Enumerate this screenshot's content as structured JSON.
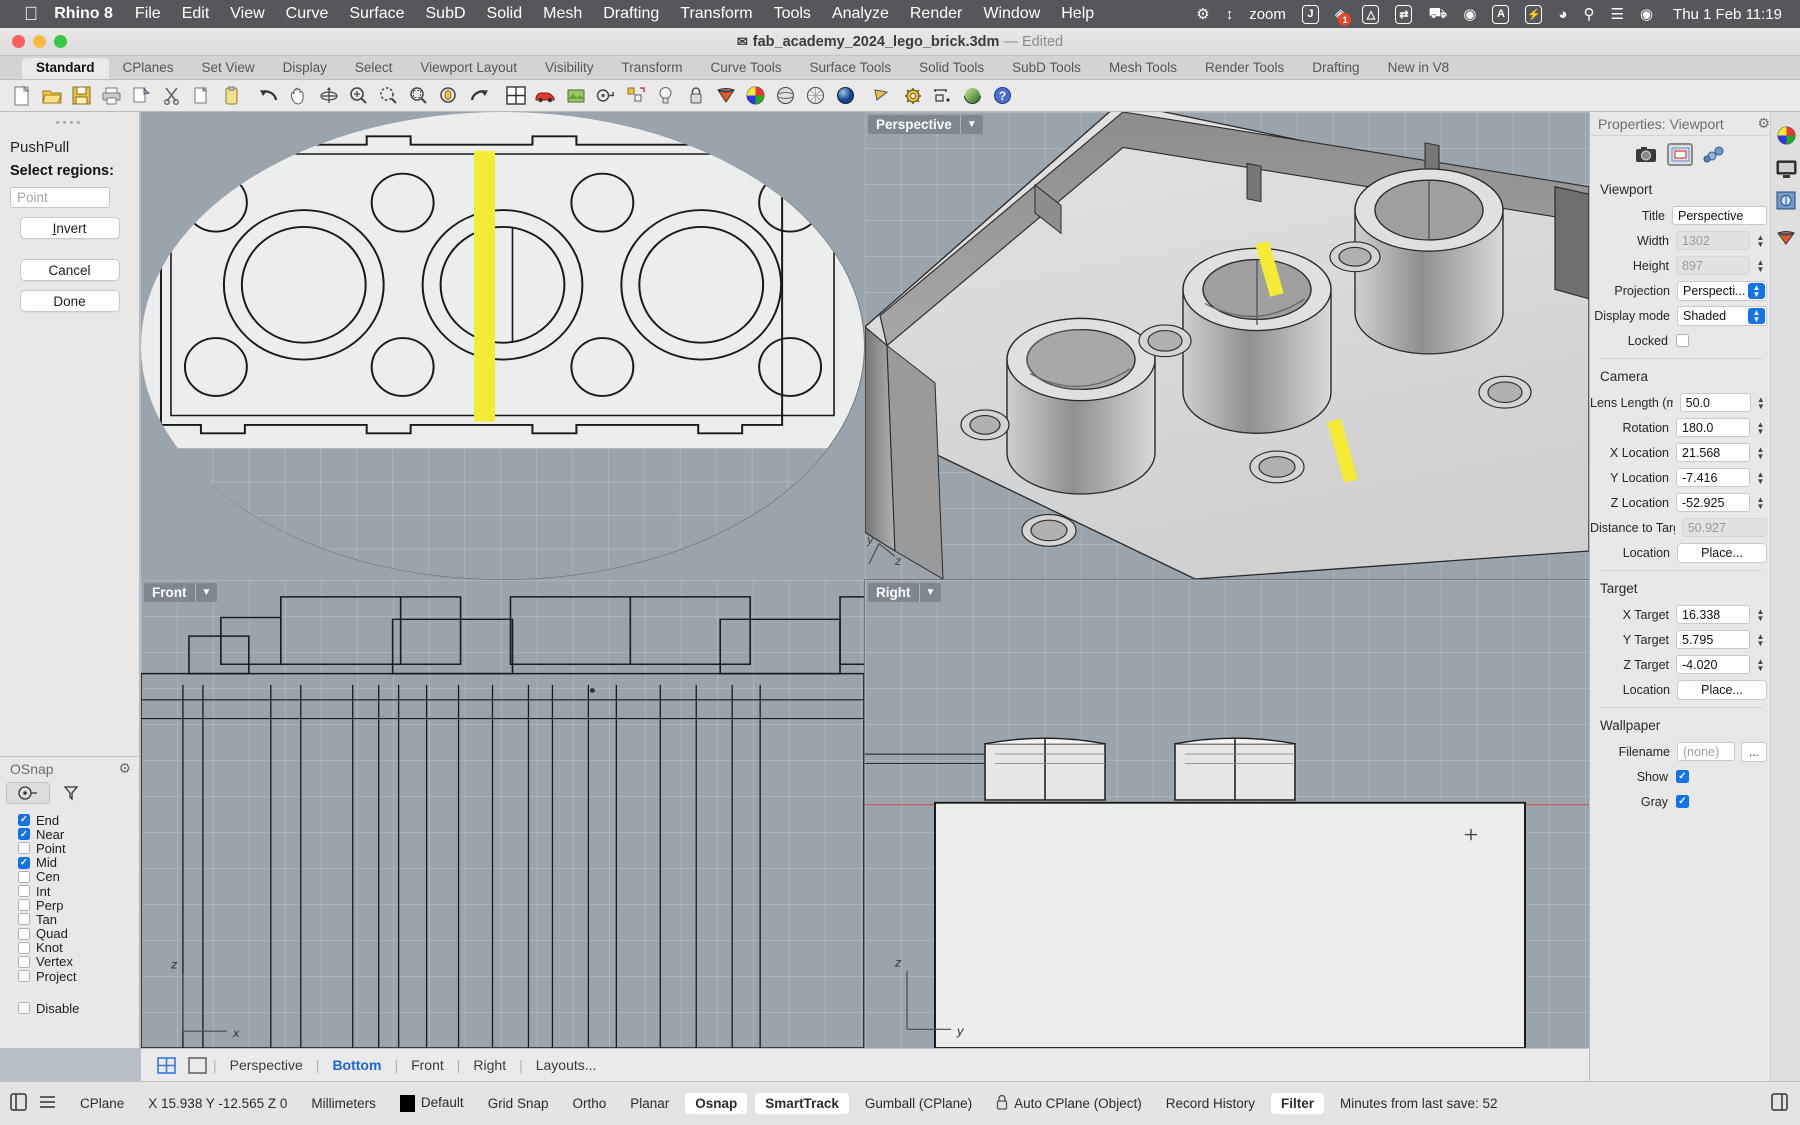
{
  "macbar": {
    "apple_icon": "apple-logo",
    "app_name": "Rhino 8",
    "menus": [
      "File",
      "Edit",
      "View",
      "Curve",
      "Surface",
      "SubD",
      "Solid",
      "Mesh",
      "Drafting",
      "Transform",
      "Tools",
      "Analyze",
      "Render",
      "Window",
      "Help"
    ],
    "status_icons": [
      "gear-icon",
      "arrows-vertical-icon",
      "zoom-label",
      "jamf-icon",
      "dropbox-icon",
      "drive-icon",
      "screenshot-icon",
      "plug-icon",
      "play-circle-icon",
      "keyboard-input-icon",
      "battery-charging-icon",
      "wifi-icon",
      "search-icon",
      "control-center-icon",
      "siri-icon"
    ],
    "zoom_label": "zoom",
    "badge_count": "1",
    "input_source": "A",
    "clock": "Thu 1 Feb  11:19"
  },
  "window": {
    "doc_icon": "rhino-doc-icon",
    "title": "fab_academy_2024_lego_brick.3dm",
    "dash": "—",
    "edited": "Edited"
  },
  "toolbar": {
    "tabs": [
      {
        "label": "Standard",
        "active": true
      },
      {
        "label": "CPlanes",
        "active": false
      },
      {
        "label": "Set View",
        "active": false
      },
      {
        "label": "Display",
        "active": false
      },
      {
        "label": "Select",
        "active": false
      },
      {
        "label": "Viewport Layout",
        "active": false
      },
      {
        "label": "Visibility",
        "active": false
      },
      {
        "label": "Transform",
        "active": false
      },
      {
        "label": "Curve Tools",
        "active": false
      },
      {
        "label": "Surface Tools",
        "active": false
      },
      {
        "label": "Solid Tools",
        "active": false
      },
      {
        "label": "SubD Tools",
        "active": false
      },
      {
        "label": "Mesh Tools",
        "active": false
      },
      {
        "label": "Render Tools",
        "active": false
      },
      {
        "label": "Drafting",
        "active": false
      },
      {
        "label": "New in V8",
        "active": false
      }
    ],
    "icons": [
      {
        "name": "new-file-icon",
        "glyph": "📄"
      },
      {
        "name": "open-file-icon",
        "glyph": "📂"
      },
      {
        "name": "save-icon",
        "glyph": "💾"
      },
      {
        "name": "print-icon",
        "glyph": "🖨"
      },
      {
        "name": "copy-to-clipboard-icon",
        "glyph": "🗒"
      },
      {
        "name": "cut-icon",
        "glyph": "✂"
      },
      {
        "name": "copy-icon",
        "glyph": "🗐"
      },
      {
        "name": "paste-icon",
        "glyph": "📋"
      },
      {
        "name": "undo-icon",
        "glyph": "↶"
      },
      {
        "name": "pan-icon",
        "glyph": "✋"
      },
      {
        "name": "rotate-view-icon",
        "glyph": "⟳"
      },
      {
        "name": "zoom-window-icon",
        "glyph": "🔍"
      },
      {
        "name": "zoom-extents-icon",
        "glyph": "⬭"
      },
      {
        "name": "zoom-selected-icon",
        "glyph": "⌕"
      },
      {
        "name": "zoom-target-icon",
        "glyph": "◎"
      },
      {
        "name": "rotate-icon",
        "glyph": "↷"
      },
      {
        "name": "viewport-layout-icon",
        "glyph": "⊞"
      },
      {
        "name": "car-render-icon",
        "glyph": "🚗"
      },
      {
        "name": "render-preview-icon",
        "glyph": "🎞"
      },
      {
        "name": "layers-icon",
        "glyph": "⊙"
      },
      {
        "name": "object-properties-icon",
        "glyph": "⚙"
      },
      {
        "name": "light-icon",
        "glyph": "💡"
      },
      {
        "name": "lock-icon",
        "glyph": "🔒"
      },
      {
        "name": "surface-icon",
        "glyph": "◣"
      },
      {
        "name": "color-wheel-icon",
        "glyph": "🎨"
      },
      {
        "name": "sphere-icon",
        "glyph": "🌑"
      },
      {
        "name": "mesh-sphere-icon",
        "glyph": "🔘"
      },
      {
        "name": "shaded-sphere-icon",
        "glyph": "🔵"
      },
      {
        "name": "gumball-icon",
        "glyph": "◤"
      },
      {
        "name": "grasshopper-icon",
        "glyph": "⚙"
      },
      {
        "name": "dimension-icon",
        "glyph": "⊢"
      },
      {
        "name": "render-sphere-icon",
        "glyph": "🟢"
      },
      {
        "name": "help-icon",
        "glyph": "❓"
      }
    ]
  },
  "command_panel": {
    "command_name": "PushPull",
    "prompt": "Select regions:",
    "input_placeholder": "Point",
    "buttons": [
      {
        "label": "Invert",
        "underline_first": true
      },
      {
        "label": "Cancel",
        "underline_first": false
      },
      {
        "label": "Done",
        "underline_first": false
      }
    ]
  },
  "osnap": {
    "title": "OSnap",
    "gear_icon": "gear-icon",
    "tabs": [
      {
        "name": "osnap-tab-points",
        "glyph": "⊶",
        "selected": true
      },
      {
        "name": "osnap-tab-filter",
        "glyph": "⌁",
        "selected": false
      }
    ],
    "items": [
      {
        "label": "End",
        "checked": true
      },
      {
        "label": "Near",
        "checked": true
      },
      {
        "label": "Point",
        "checked": false
      },
      {
        "label": "Mid",
        "checked": true
      },
      {
        "label": "Cen",
        "checked": false
      },
      {
        "label": "Int",
        "checked": false
      },
      {
        "label": "Perp",
        "checked": false
      },
      {
        "label": "Tan",
        "checked": false
      },
      {
        "label": "Quad",
        "checked": false
      },
      {
        "label": "Knot",
        "checked": false
      },
      {
        "label": "Vertex",
        "checked": false
      },
      {
        "label": "Project",
        "checked": false
      }
    ],
    "disable": {
      "label": "Disable",
      "checked": false
    }
  },
  "viewports": [
    {
      "name": "Bottom",
      "active": true
    },
    {
      "name": "Perspective",
      "active": false
    },
    {
      "name": "Front",
      "active": false
    },
    {
      "name": "Right",
      "active": false
    }
  ],
  "viewport_tabs": {
    "four_view_icon": "four-view-icon",
    "single_view_icon": "single-view-icon",
    "tabs": [
      {
        "label": "Perspective",
        "on": false
      },
      {
        "label": "Bottom",
        "on": true
      },
      {
        "label": "Front",
        "on": false
      },
      {
        "label": "Right",
        "on": false
      },
      {
        "label": "Layouts...",
        "on": false
      }
    ]
  },
  "properties": {
    "header": "Properties: Viewport",
    "gear_icon": "gear-icon",
    "tab_icons": [
      {
        "name": "camera-properties-icon",
        "glyph": "📷",
        "selected": false
      },
      {
        "name": "viewport-properties-icon",
        "glyph": "▣",
        "selected": true
      },
      {
        "name": "display-properties-icon",
        "glyph": "🔗",
        "selected": false
      }
    ],
    "sections": [
      {
        "title": "Viewport",
        "rows": [
          {
            "label": "Title",
            "type": "text",
            "value": "Perspective",
            "readonly": false
          },
          {
            "label": "Width",
            "type": "stepper",
            "value": "1302",
            "readonly": true
          },
          {
            "label": "Height",
            "type": "stepper",
            "value": "897",
            "readonly": true
          },
          {
            "label": "Projection",
            "type": "combo",
            "value": "Perspecti..."
          },
          {
            "label": "Display mode",
            "type": "combo",
            "value": "Shaded"
          },
          {
            "label": "Locked",
            "type": "checkbox",
            "checked": false
          }
        ]
      },
      {
        "title": "Camera",
        "rows": [
          {
            "label": "Lens Length (m",
            "type": "stepper",
            "value": "50.0",
            "readonly": false
          },
          {
            "label": "Rotation",
            "type": "stepper",
            "value": "180.0",
            "readonly": false
          },
          {
            "label": "X Location",
            "type": "stepper",
            "value": "21.568",
            "readonly": false
          },
          {
            "label": "Y Location",
            "type": "stepper",
            "value": "-7.416",
            "readonly": false
          },
          {
            "label": "Z Location",
            "type": "stepper",
            "value": "-52.925",
            "readonly": false
          },
          {
            "label": "Distance to Targ",
            "type": "text",
            "value": "50.927",
            "readonly": true
          },
          {
            "label": "Location",
            "type": "button",
            "value": "Place..."
          }
        ]
      },
      {
        "title": "Target",
        "rows": [
          {
            "label": "X Target",
            "type": "stepper",
            "value": "16.338",
            "readonly": false
          },
          {
            "label": "Y Target",
            "type": "stepper",
            "value": "5.795",
            "readonly": false
          },
          {
            "label": "Z Target",
            "type": "stepper",
            "value": "-4.020",
            "readonly": false
          },
          {
            "label": "Location",
            "type": "button",
            "value": "Place..."
          }
        ]
      },
      {
        "title": "Wallpaper",
        "rows": [
          {
            "label": "Filename",
            "type": "file",
            "value": "(none)",
            "browse": "..."
          },
          {
            "label": "Show",
            "type": "checkbox",
            "checked": true
          },
          {
            "label": "Gray",
            "type": "checkbox",
            "checked": true
          }
        ]
      }
    ],
    "side_icons": [
      {
        "name": "color-wheel-icon",
        "glyph": "🎨"
      },
      {
        "name": "display-monitor-icon",
        "glyph": "🖥"
      },
      {
        "name": "render-settings-icon",
        "glyph": "🖼"
      },
      {
        "name": "material-icon",
        "glyph": "◣"
      }
    ]
  },
  "statusbar": {
    "left_icons": [
      "panel-toggle-icon",
      "list-icon"
    ],
    "cplane_label": "CPlane",
    "coords": "X 15.938  Y -12.565  Z 0",
    "units": "Millimeters",
    "layer_swatch": "#000000",
    "layer": "Default",
    "toggles": [
      {
        "label": "Grid Snap",
        "on": false
      },
      {
        "label": "Ortho",
        "on": false
      },
      {
        "label": "Planar",
        "on": false
      },
      {
        "label": "Osnap",
        "on": true
      },
      {
        "label": "SmartTrack",
        "on": true
      },
      {
        "label": "Gumball (CPlane)",
        "on": false
      }
    ],
    "lock_icon": "lock-icon",
    "auto_cplane": "Auto CPlane (Object)",
    "record_history": "Record History",
    "filter": {
      "label": "Filter",
      "on": true
    },
    "last_save": "Minutes from last save: 52",
    "right_icon": "panel-toggle-right-icon"
  },
  "colors": {
    "accent_blue": "#1473e6",
    "active_viewport_label": "#2c5d9b",
    "idle_viewport_label": "#7e868f",
    "highlight_yellow": "#f5eb34",
    "viewport_bg": "#9aa4ad",
    "ortho_bg": "#eceded",
    "tab_link_blue": "#1a66d6"
  }
}
